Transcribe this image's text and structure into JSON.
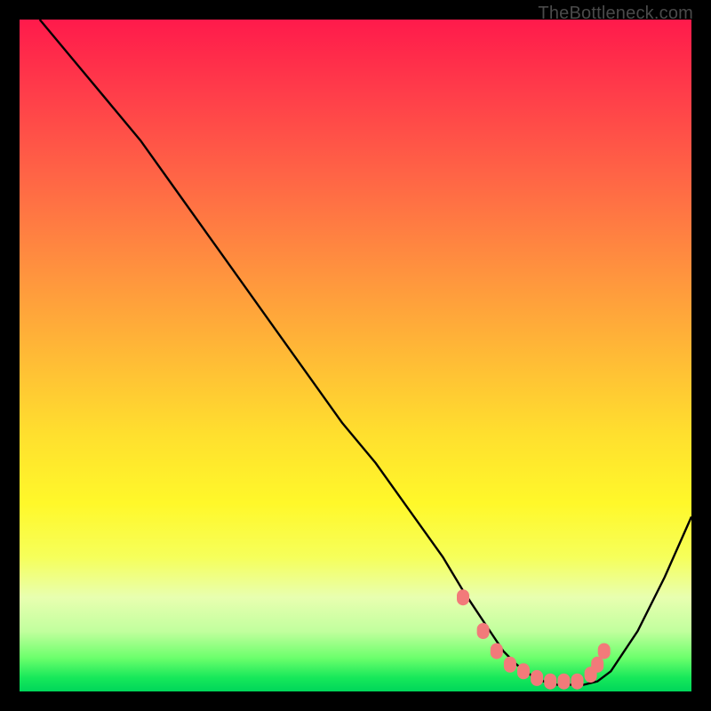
{
  "watermark": "TheBottleneck.com",
  "chart_data": {
    "type": "line",
    "title": "",
    "xlabel": "",
    "ylabel": "",
    "xlim": [
      0,
      100
    ],
    "ylim": [
      0,
      100
    ],
    "series": [
      {
        "name": "bottleneck-curve",
        "x": [
          3,
          8,
          13,
          18,
          23,
          28,
          33,
          38,
          43,
          48,
          53,
          58,
          63,
          66,
          68,
          70,
          72,
          74,
          76,
          78,
          80,
          82,
          84,
          86,
          88,
          92,
          96,
          100
        ],
        "y": [
          100,
          94,
          88,
          82,
          75,
          68,
          61,
          54,
          47,
          40,
          34,
          27,
          20,
          15,
          12,
          9,
          6,
          4,
          2.5,
          1.5,
          1,
          1,
          1,
          1.5,
          3,
          9,
          17,
          26
        ]
      },
      {
        "name": "highlight-dots",
        "x": [
          66,
          69,
          71,
          73,
          75,
          77,
          79,
          81,
          83,
          85,
          86,
          87
        ],
        "y": [
          14,
          9,
          6,
          4,
          3,
          2,
          1.5,
          1.5,
          1.5,
          2.5,
          4,
          6
        ]
      }
    ],
    "colors": {
      "curve": "#000000",
      "dots": "#f27a7a"
    }
  }
}
